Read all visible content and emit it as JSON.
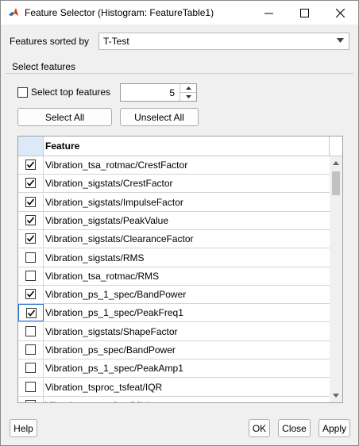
{
  "window": {
    "title": "Feature Selector (Histogram: FeatureTable1)"
  },
  "sort": {
    "label": "Features sorted by",
    "value": "T-Test"
  },
  "select_features": {
    "group_label": "Select features",
    "top_label": "Select top features",
    "top_checked": false,
    "top_count": "5",
    "select_all_label": "Select All",
    "unselect_all_label": "Unselect All"
  },
  "table": {
    "column_feature": "Feature",
    "rows": [
      {
        "name": "Vibration_tsa_rotmac/CrestFactor",
        "checked": true
      },
      {
        "name": "Vibration_sigstats/CrestFactor",
        "checked": true
      },
      {
        "name": "Vibration_sigstats/ImpulseFactor",
        "checked": true
      },
      {
        "name": "Vibration_sigstats/PeakValue",
        "checked": true
      },
      {
        "name": "Vibration_sigstats/ClearanceFactor",
        "checked": true
      },
      {
        "name": "Vibration_sigstats/RMS",
        "checked": false
      },
      {
        "name": "Vibration_tsa_rotmac/RMS",
        "checked": false
      },
      {
        "name": "Vibration_ps_1_spec/BandPower",
        "checked": true
      },
      {
        "name": "Vibration_ps_1_spec/PeakFreq1",
        "checked": true
      },
      {
        "name": "Vibration_sigstats/ShapeFactor",
        "checked": false
      },
      {
        "name": "Vibration_ps_spec/BandPower",
        "checked": false
      },
      {
        "name": "Vibration_ps_1_spec/PeakAmp1",
        "checked": false
      },
      {
        "name": "Vibration_tsproc_tsfeat/IQR",
        "checked": false
      },
      {
        "name": "Vibration_tsa_tsfeat/Minimum",
        "checked": false
      }
    ]
  },
  "buttons": {
    "help": "Help",
    "ok": "OK",
    "close": "Close",
    "apply": "Apply"
  },
  "colors": {
    "focus_border": "#1f6fd1",
    "header_selected_bg": "#dbe9f9"
  },
  "icons": {
    "app": "matlab-logo-icon",
    "minimize": "minimize-icon",
    "maximize": "maximize-icon",
    "close": "close-icon",
    "dropdown": "chevron-down-icon",
    "check": "check-icon"
  }
}
